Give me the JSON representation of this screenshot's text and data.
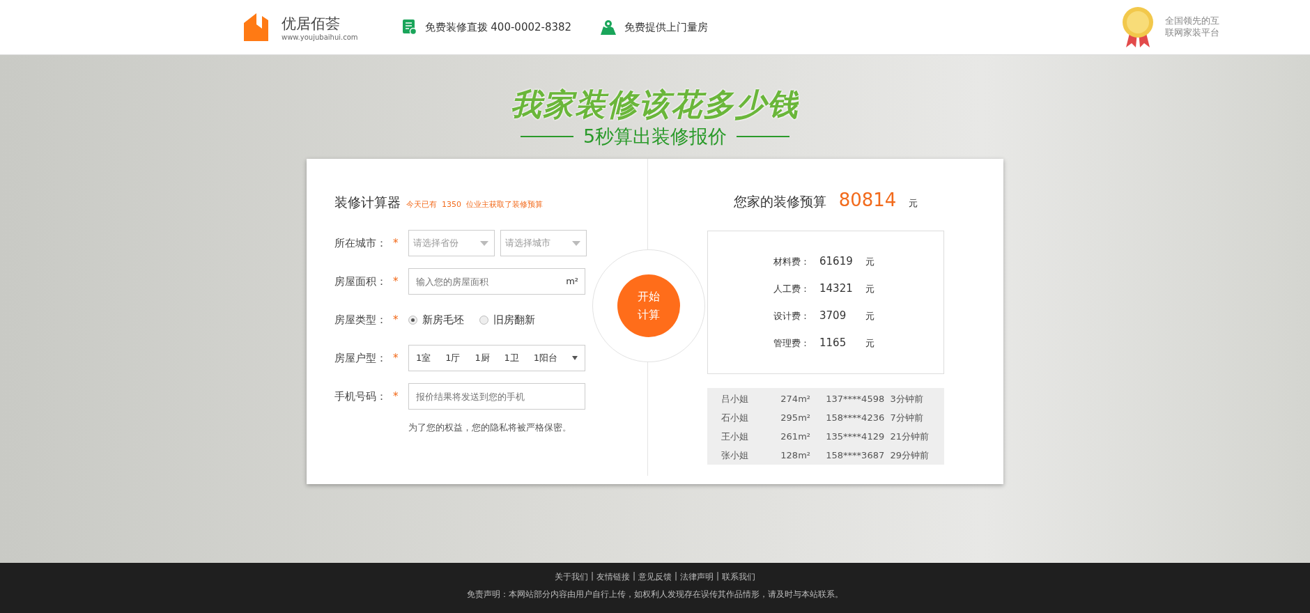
{
  "header": {
    "brand": "优居佰荟",
    "url": "www.youjubaihui.com",
    "hotline": "免费装修直拨 400-0002-8382",
    "measure": "免费提供上门量房",
    "badge": "全国领先的互联网家装平台"
  },
  "hero": {
    "title": "我家装修该花多少钱",
    "subtitle": "5秒算出装修报价"
  },
  "calculator": {
    "title": "装修计算器",
    "required_mark": "*",
    "notice": "今天已有  1350  位业主获取了装修预算",
    "city": {
      "label": "所在城市：",
      "province_placeholder": "请选择省份",
      "city_placeholder": "请选择城市"
    },
    "area": {
      "label": "房屋面积：",
      "placeholder": "输入您的房屋面积",
      "unit": "m²"
    },
    "house_type": {
      "label": "房屋类型：",
      "options": [
        {
          "label": "新房毛坯",
          "selected": true
        },
        {
          "label": "旧房翻新",
          "selected": false
        }
      ]
    },
    "layout": {
      "label": "房屋户型：",
      "parts": [
        "1室",
        "1厅",
        "1厨",
        "1卫",
        "1阳台"
      ]
    },
    "phone": {
      "label": "手机号码：",
      "placeholder": "报价结果将发送到您的手机"
    },
    "privacy": "为了您的权益，您的隐私将被严格保密。",
    "button": "开始计算"
  },
  "budget": {
    "title": "您家的装修预算",
    "total": "80814",
    "unit": "元",
    "items": [
      {
        "label": "材料费：",
        "value": "61619",
        "unit": "元"
      },
      {
        "label": "人工费：",
        "value": "14321",
        "unit": "元"
      },
      {
        "label": "设计费：",
        "value": "3709",
        "unit": "元"
      },
      {
        "label": "管理费：",
        "value": "1165",
        "unit": "元"
      }
    ],
    "recent": [
      [
        "吕小姐",
        "274m²",
        "137****4598",
        "3分钟前"
      ],
      [
        "石小姐",
        "295m²",
        "158****4236",
        "7分钟前"
      ],
      [
        "王小姐",
        "261m²",
        "135****4129",
        "21分钟前"
      ],
      [
        "张小姐",
        "128m²",
        "158****3687",
        "29分钟前"
      ]
    ]
  },
  "footer": {
    "separator": "|",
    "links": [
      "关于我们",
      "友情链接",
      "意见反馈",
      "法律声明",
      "联系我们"
    ],
    "disclaimer": "免责声明：本网站部分内容由用户自行上传，如权利人发现存在误传其作品情形，请及时与本站联系。"
  }
}
